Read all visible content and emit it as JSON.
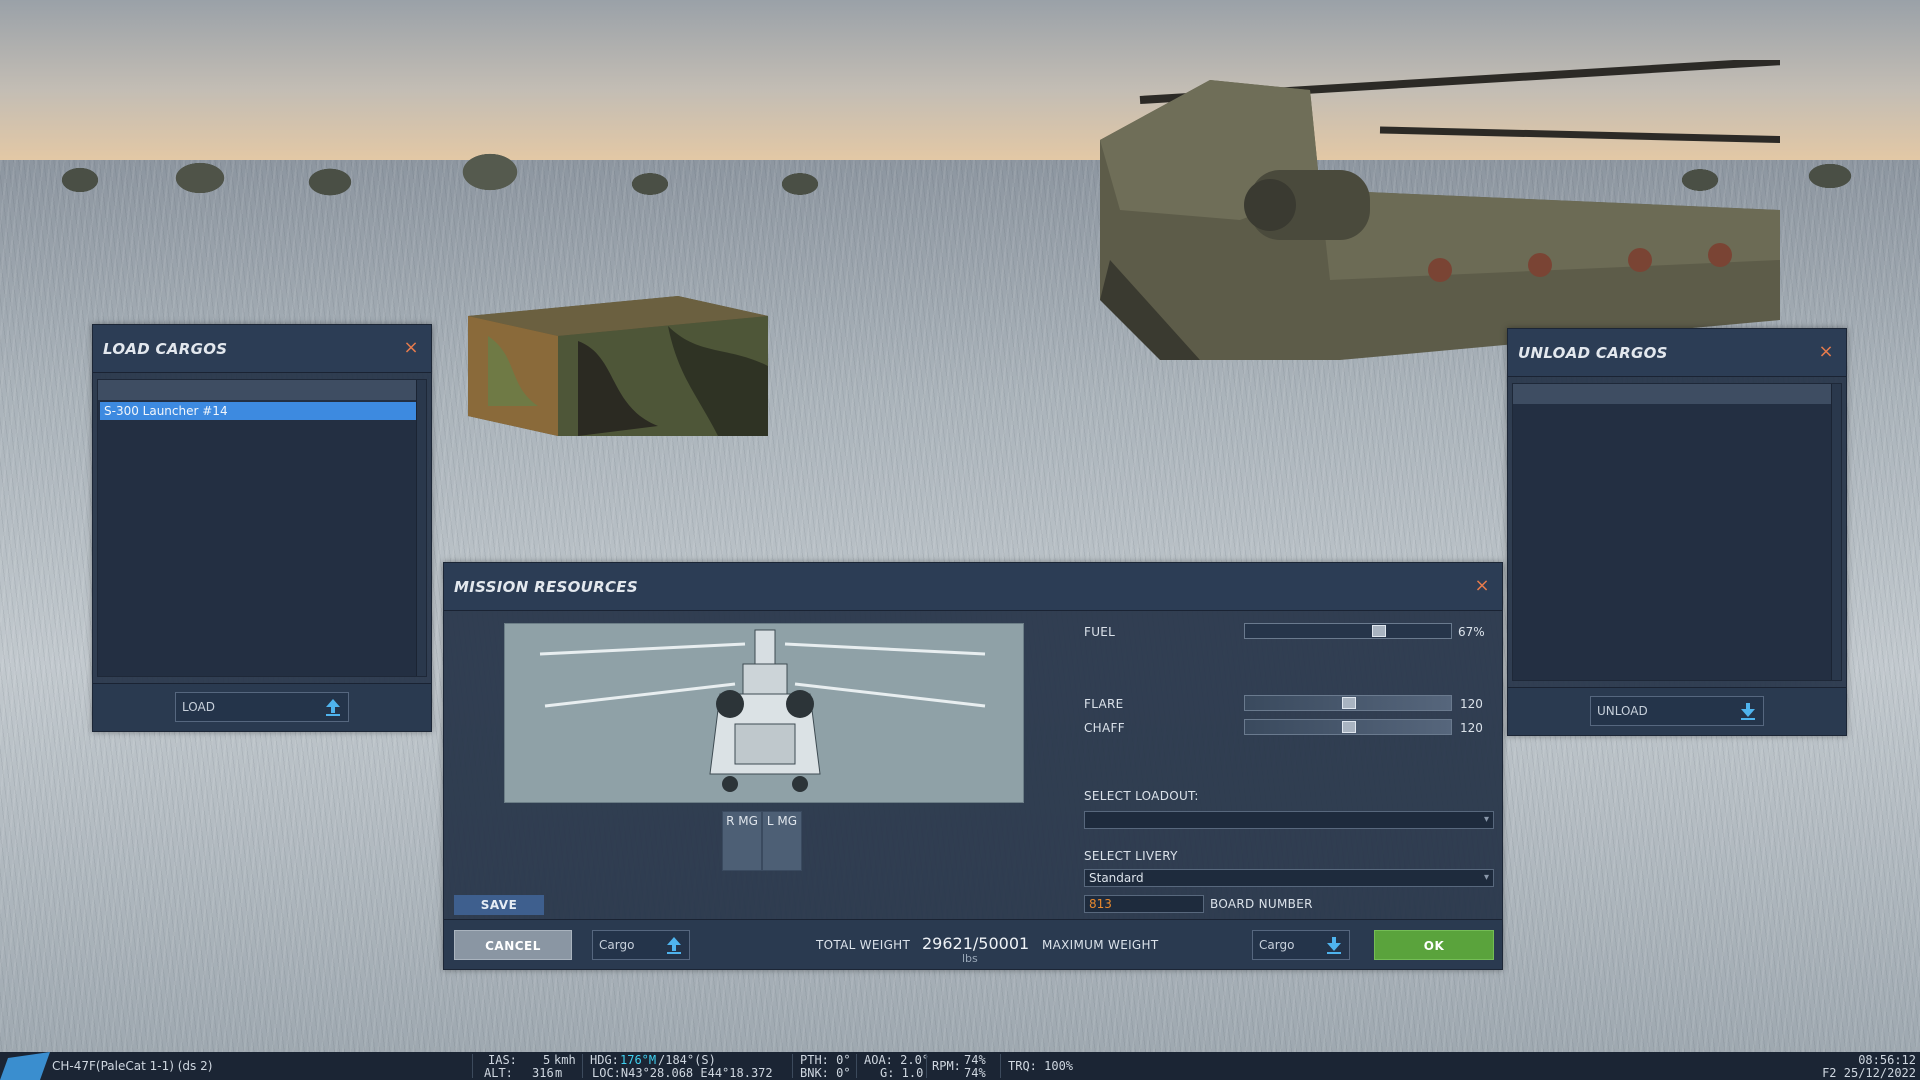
{
  "load_panel": {
    "title": "LOAD CARGOS",
    "close": "×",
    "items": [
      "S-300 Launcher #14"
    ],
    "combo_label": "LOAD"
  },
  "unload_panel": {
    "title": "UNLOAD CARGOS",
    "close": "×",
    "combo_label": "UNLOAD"
  },
  "mission": {
    "title": "MISSION RESOURCES",
    "close": "×",
    "mg_right": "R MG",
    "mg_left": "L MG",
    "fuel_label": "FUEL",
    "fuel_value": "67%",
    "fuel_fraction": 0.67,
    "flare_label": "FLARE",
    "flare_value": "120",
    "chaff_label": "CHAFF",
    "chaff_value": "120",
    "loadout_label": "SELECT LOADOUT:",
    "loadout_value": "",
    "livery_label": "SELECT LIVERY",
    "livery_value": "Standard",
    "board_number": "813",
    "board_number_label": "BOARD NUMBER",
    "save": "SAVE",
    "cancel": "CANCEL",
    "cargo_left": "Cargo",
    "total_weight_label": "TOTAL WEIGHT",
    "total_weight": "29621/50001",
    "weight_unit": "lbs",
    "max_weight_label": "MAXIMUM WEIGHT",
    "cargo_right": "Cargo",
    "ok": "OK"
  },
  "statusbar": {
    "unit": "CH-47F(PaleCat 1-1) (ds 2)",
    "ias_label": "IAS:",
    "ias_value": "5",
    "ias_unit": "kmh",
    "alt_label": "ALT:",
    "alt_value": "316",
    "alt_unit": "m",
    "hdg_label": "HDG:",
    "hdg_mag": "176°M",
    "hdg_rest": "/184°(S)",
    "loc": "LOC:N43°28.068 E44°18.372",
    "pth": "PTH: 0°",
    "bnk": "BNK: 0°",
    "aoa": "AOA: 2.0°",
    "g": "G: 1.0",
    "rpm_label": "RPM:",
    "rpm1": "74%",
    "rpm2": "74%",
    "trq": "TRQ: 100%",
    "time": "08:56:12",
    "date": "F2 25/12/2022"
  },
  "colors": {
    "accent_close": "#e77b4c",
    "selected_item": "#3d8ae0",
    "ok_button": "#5aa33c",
    "board_number_text": "#e8892e",
    "hdg_highlight": "#3fd0ef"
  }
}
